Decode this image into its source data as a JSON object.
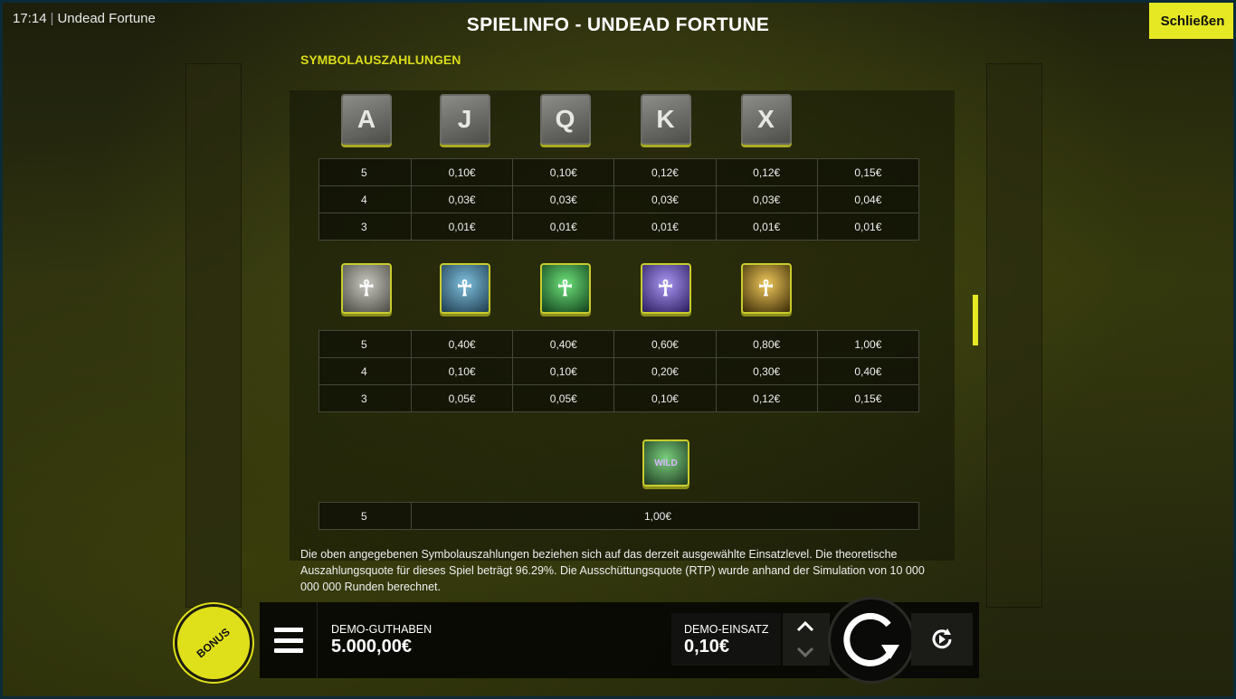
{
  "status": {
    "time": "17:14",
    "game_name": "Undead Fortune"
  },
  "header": {
    "title": "SPIELINFO - UNDEAD FORTUNE",
    "close_label": "Schließen"
  },
  "paytable": {
    "section_title": "SYMBOLAUSZAHLUNGEN",
    "low_symbols": [
      {
        "icon": "stone-rune-a-icon",
        "glyph": "A"
      },
      {
        "icon": "stone-rune-j-icon",
        "glyph": "J"
      },
      {
        "icon": "stone-rune-q-icon",
        "glyph": "Q"
      },
      {
        "icon": "stone-rune-k-icon",
        "glyph": "K"
      },
      {
        "icon": "stone-rune-ten-icon",
        "glyph": "X"
      }
    ],
    "low_rows": [
      {
        "count": "5",
        "values": [
          "0,10€",
          "0,10€",
          "0,12€",
          "0,12€",
          "0,15€"
        ]
      },
      {
        "count": "4",
        "values": [
          "0,03€",
          "0,03€",
          "0,03€",
          "0,03€",
          "0,04€"
        ]
      },
      {
        "count": "3",
        "values": [
          "0,01€",
          "0,01€",
          "0,01€",
          "0,01€",
          "0,01€"
        ]
      }
    ],
    "high_symbols": [
      {
        "icon": "mummy-symbol-icon",
        "color": "#8a8a82"
      },
      {
        "icon": "blue-creature-symbol-icon",
        "color": "#3f7fa0"
      },
      {
        "icon": "green-pharaoh-symbol-icon",
        "color": "#2e9a3a"
      },
      {
        "icon": "purple-anubis-symbol-icon",
        "color": "#6a4fc9"
      },
      {
        "icon": "gold-anubis-symbol-icon",
        "color": "#c79a2a"
      }
    ],
    "high_rows": [
      {
        "count": "5",
        "values": [
          "0,40€",
          "0,40€",
          "0,60€",
          "0,80€",
          "1,00€"
        ]
      },
      {
        "count": "4",
        "values": [
          "0,10€",
          "0,10€",
          "0,20€",
          "0,30€",
          "0,40€"
        ]
      },
      {
        "count": "3",
        "values": [
          "0,05€",
          "0,05€",
          "0,10€",
          "0,12€",
          "0,15€"
        ]
      }
    ],
    "wild": {
      "icon": "wild-symbol-icon",
      "label": "WILD",
      "count": "5",
      "value": "1,00€"
    },
    "description": "Die oben angegebenen Symbolauszahlungen beziehen sich auf das derzeit ausgewählte Einsatzlevel. Die theoretische Auszahlungsquote für dieses Spiel beträgt 96.29%. Die Ausschüttungsquote (RTP) wurde anhand der Simulation von 10 000 000 000 Runden berechnet."
  },
  "controls": {
    "bonus_label": "BONUS",
    "balance_label": "DEMO-GUTHABEN",
    "balance_value": "5.000,00€",
    "bet_label": "DEMO-EINSATZ",
    "bet_value": "0,10€",
    "accent": "#e6e823"
  }
}
